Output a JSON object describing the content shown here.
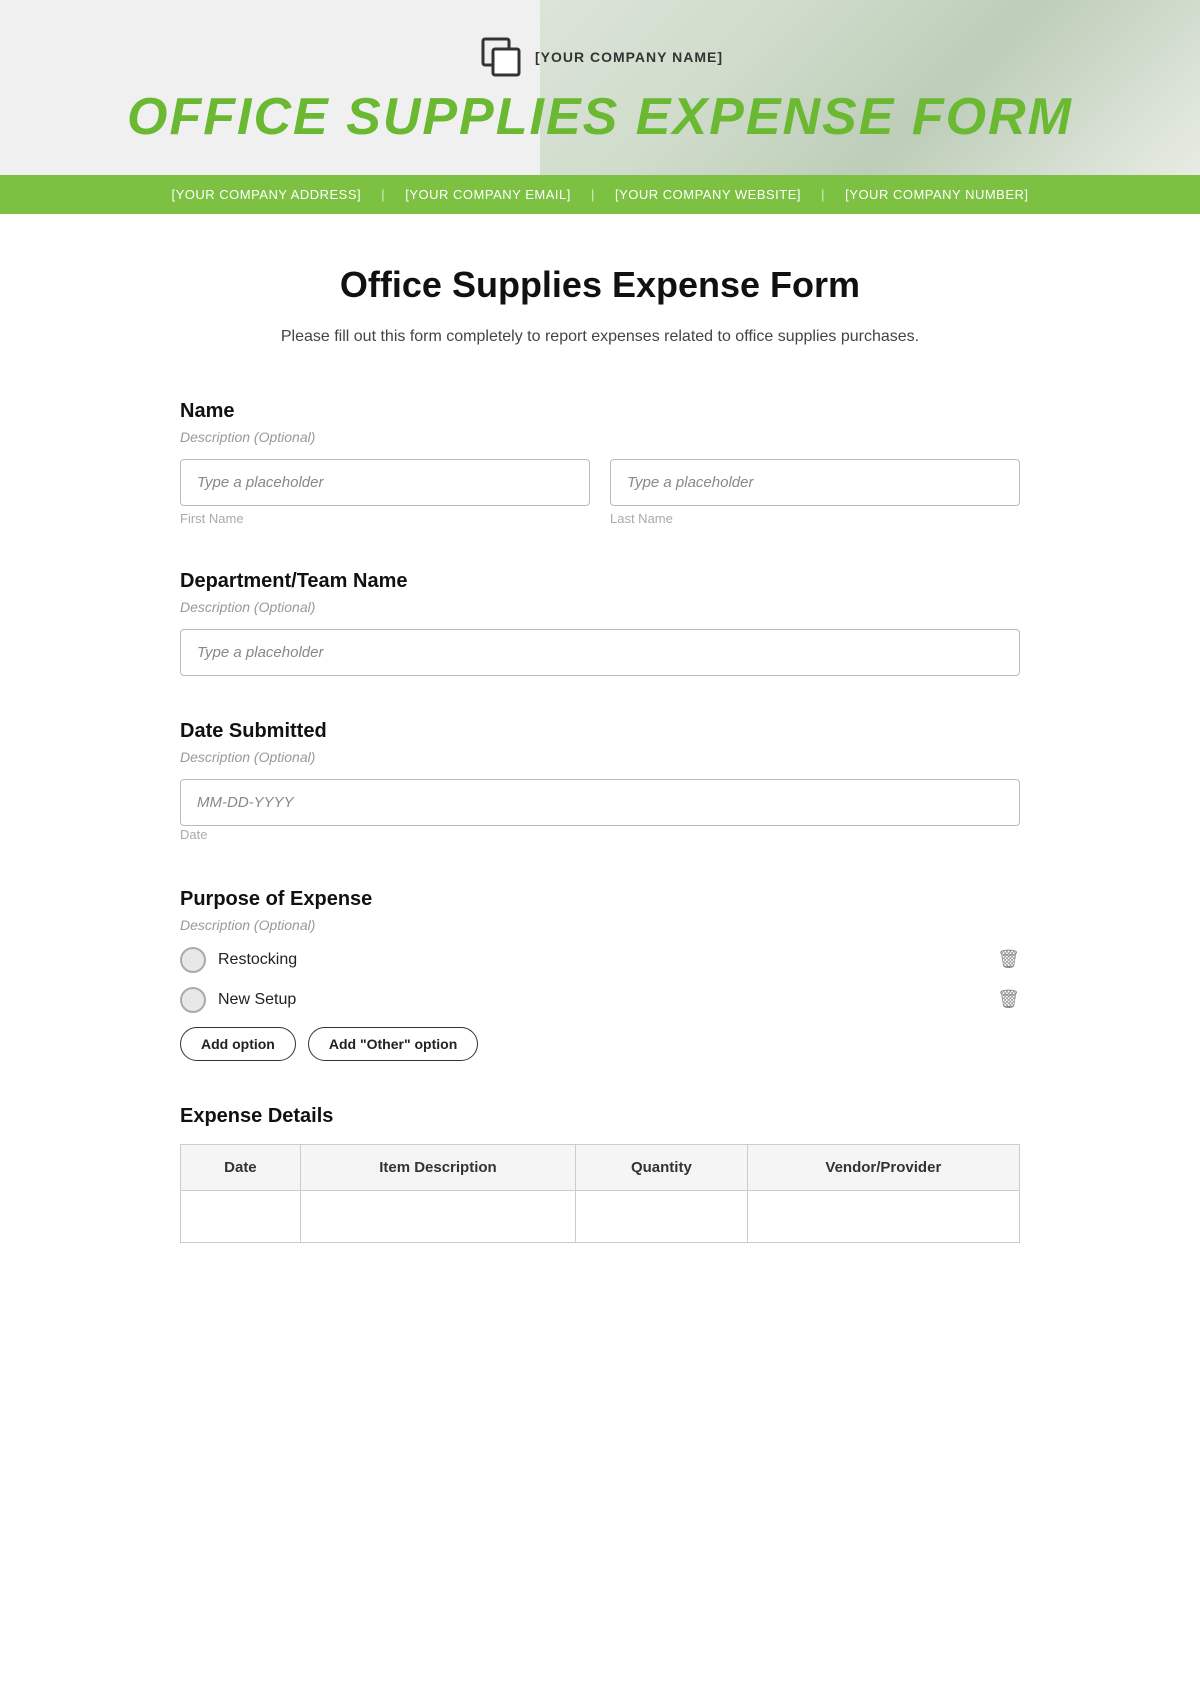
{
  "header": {
    "company_name": "[YOUR COMPANY NAME]",
    "title": "OFFICE SUPPLIES EXPENSE FORM"
  },
  "info_bar": {
    "address": "[YOUR COMPANY ADDRESS]",
    "email": "[YOUR COMPANY EMAIL]",
    "website": "[YOUR COMPANY WEBSITE]",
    "number": "[YOUR COMPANY NUMBER]"
  },
  "form": {
    "page_title": "Office Supplies Expense Form",
    "page_subtitle": "Please fill out this form completely to report expenses related to office supplies purchases.",
    "sections": {
      "name": {
        "label": "Name",
        "description": "Description (Optional)",
        "first_name_placeholder": "Type a placeholder",
        "last_name_placeholder": "Type a placeholder",
        "first_name_sublabel": "First Name",
        "last_name_sublabel": "Last Name"
      },
      "department": {
        "label": "Department/Team Name",
        "description": "Description (Optional)",
        "placeholder": "Type a placeholder"
      },
      "date_submitted": {
        "label": "Date Submitted",
        "description": "Description (Optional)",
        "placeholder": "MM-DD-YYYY",
        "sublabel": "Date"
      },
      "purpose": {
        "label": "Purpose of Expense",
        "description": "Description (Optional)",
        "options": [
          "Restocking",
          "New Setup"
        ],
        "add_option_label": "Add option",
        "add_other_label": "Add \"Other\" option"
      },
      "expense_details": {
        "label": "Expense Details",
        "table_headers": [
          "Date",
          "Item Description",
          "Quantity",
          "Vendor/Provider"
        ]
      }
    }
  }
}
